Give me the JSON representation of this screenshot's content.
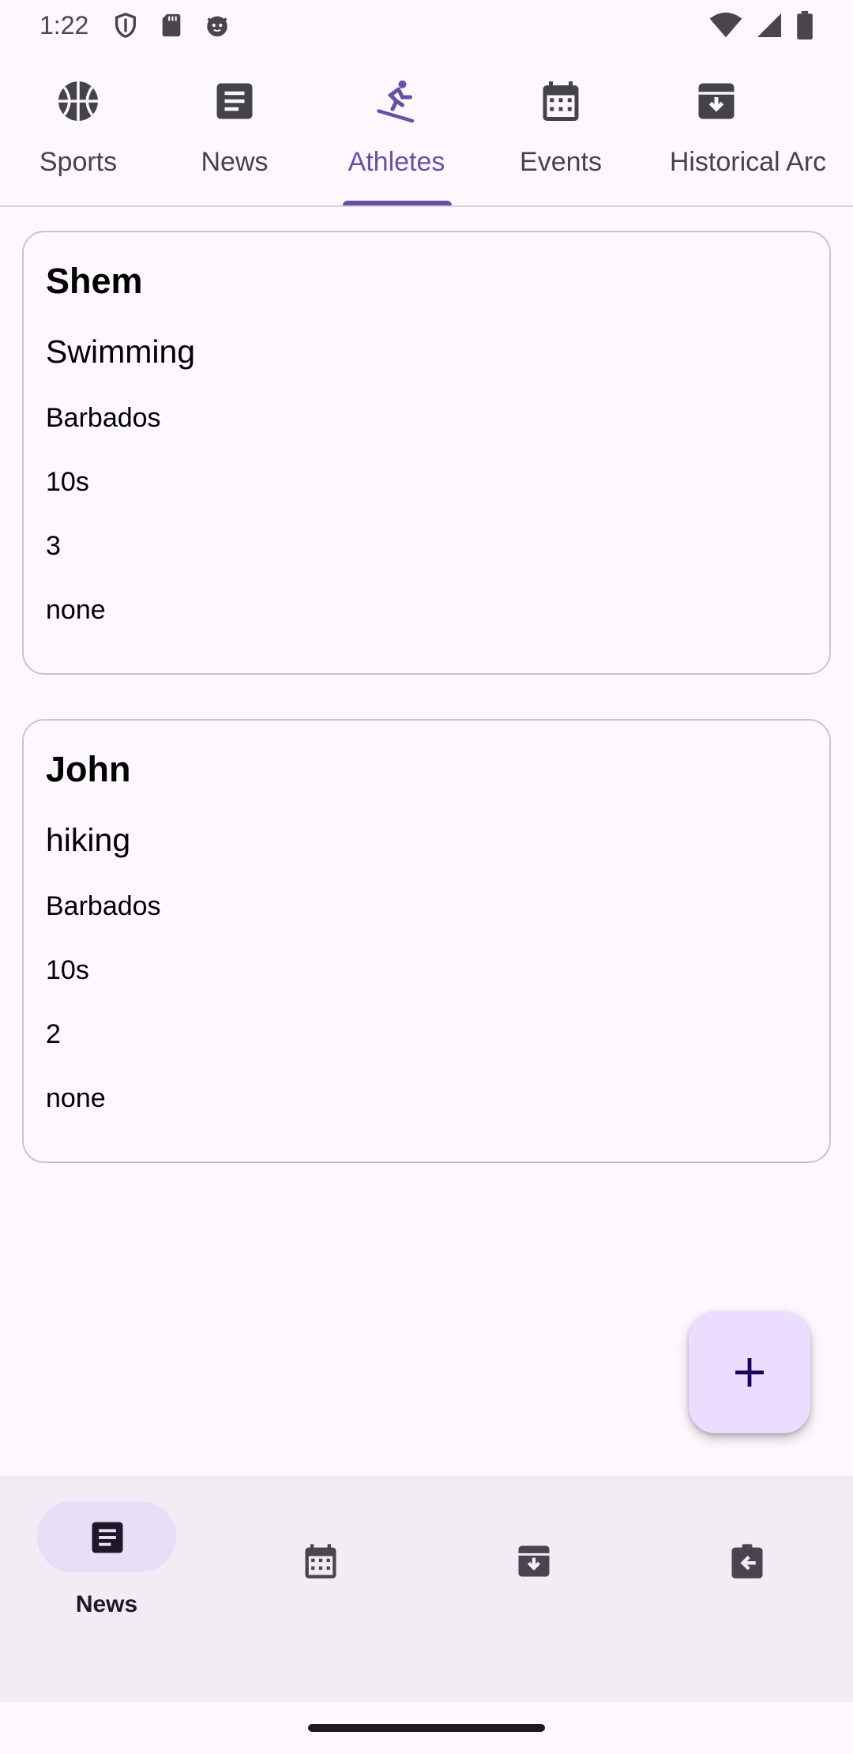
{
  "status_bar": {
    "time": "1:22",
    "icons": [
      "shield-icon",
      "sd-card-icon",
      "cat-face-icon",
      "wifi-icon",
      "cell-signal-icon",
      "battery-icon"
    ]
  },
  "top_tabs": [
    {
      "label": "Sports",
      "icon": "basketball-icon",
      "active": false
    },
    {
      "label": "News",
      "icon": "article-icon",
      "active": false
    },
    {
      "label": "Athletes",
      "icon": "skiing-person-icon",
      "active": true
    },
    {
      "label": "Events",
      "icon": "calendar-icon",
      "active": false
    },
    {
      "label": "Historical Arc",
      "icon": "archive-icon",
      "active": false
    }
  ],
  "athletes": [
    {
      "name": "Shem",
      "sport": "Swimming",
      "country": "Barbados",
      "time": "10s",
      "count": "3",
      "note": "none"
    },
    {
      "name": "John",
      "sport": "hiking",
      "country": "Barbados",
      "time": "10s",
      "count": "2",
      "note": "none"
    }
  ],
  "fab": {
    "icon": "plus-icon"
  },
  "bottom_nav": [
    {
      "label": "News",
      "icon": "article-icon",
      "active": true
    },
    {
      "label": "",
      "icon": "calendar-icon",
      "active": false
    },
    {
      "label": "",
      "icon": "archive-icon",
      "active": false
    },
    {
      "label": "",
      "icon": "assignment-return-icon",
      "active": false
    }
  ],
  "colors": {
    "background": "#FDF7FE",
    "accent": "#6750A4",
    "fab": "#EADDFF",
    "nav_bar": "#F2ECF4",
    "nav_pill": "#E8DEF8"
  }
}
